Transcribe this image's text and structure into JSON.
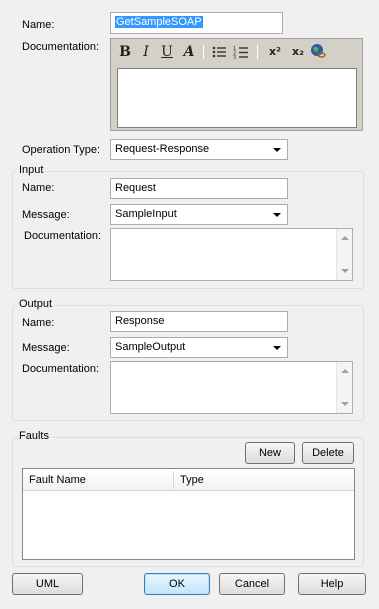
{
  "form": {
    "name_label": "Name:",
    "name_value": "GetSampleSOAP",
    "documentation_label": "Documentation:",
    "operation_type_label": "Operation Type:",
    "operation_type_value": "Request-Response"
  },
  "toolbar": {
    "bold": "B",
    "italic": "I",
    "underline": "U",
    "font_color": "A",
    "superscript": "x²",
    "subscript": "x₂"
  },
  "input": {
    "group_title": "Input",
    "name_label": "Name:",
    "name_value": "Request",
    "message_label": "Message:",
    "message_value": "SampleInput",
    "documentation_label": "Documentation:"
  },
  "output": {
    "group_title": "Output",
    "name_label": "Name:",
    "name_value": "Response",
    "message_label": "Message:",
    "message_value": "SampleOutput",
    "documentation_label": "Documentation:"
  },
  "faults": {
    "group_title": "Faults",
    "new_button": "New",
    "delete_button": "Delete",
    "columns": [
      "Fault Name",
      "Type"
    ]
  },
  "footer": {
    "uml_button": "UML",
    "ok_button": "OK",
    "cancel_button": "Cancel",
    "help_button": "Help"
  },
  "icons": {
    "bullets": "bullet-list-icon",
    "numbering": "numbered-list-icon",
    "hyperlink": "globe-link-icon"
  }
}
